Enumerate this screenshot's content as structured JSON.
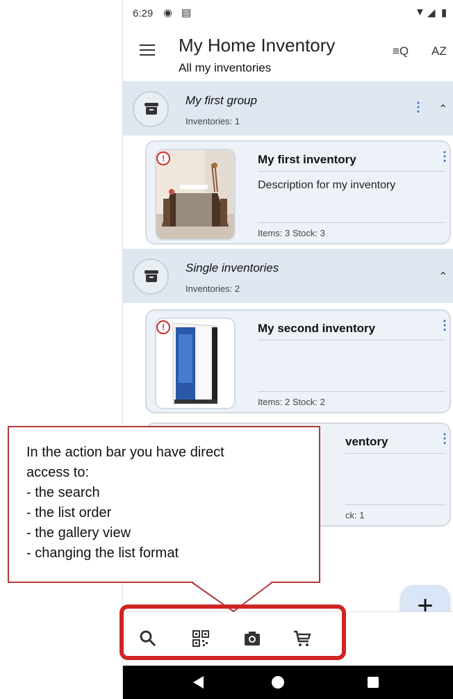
{
  "status_bar": {
    "time": "6:29",
    "icons": [
      "signal-icon",
      "gallery-icon",
      "wifi-icon",
      "network-icon",
      "battery-icon"
    ]
  },
  "app_bar": {
    "title": "My Home Inventory",
    "subtitle": "All my inventories",
    "search_list_label": "≡Q",
    "sort_label": "AZ"
  },
  "groups": [
    {
      "title": "My first group",
      "count": "Inventories: 1"
    },
    {
      "title": "Single inventories",
      "count": "Inventories: 2"
    }
  ],
  "inventories": [
    {
      "title": "My first inventory",
      "description": "Description for my inventory",
      "stats": "Items: 3   Stock: 3"
    },
    {
      "title": "My second inventory",
      "description": "",
      "stats": "Items: 2   Stock: 2"
    },
    {
      "title": "ventory",
      "description": "",
      "stats": "ck: 1"
    }
  ],
  "bottom_bar": {
    "items": [
      "search-icon",
      "qr-code-icon",
      "camera-icon",
      "cart-icon"
    ]
  },
  "fab": {
    "label": "+"
  },
  "callout": {
    "lines": [
      "In the action bar you have direct",
      "access to:",
      "- the search",
      "- the list order",
      "- the gallery view",
      "- changing the list format"
    ]
  },
  "colors": {
    "accent": "#2f6cc4",
    "group_bg": "#dfe7f1",
    "card_bg": "#edf2f8",
    "highlight": "#d02424",
    "warning": "#d02c2c"
  }
}
